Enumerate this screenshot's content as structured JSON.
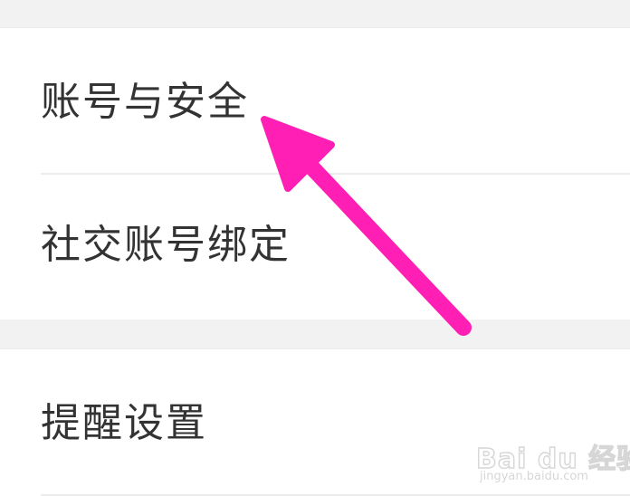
{
  "settings": {
    "items": [
      {
        "label": "账号与安全"
      },
      {
        "label": "社交账号绑定"
      },
      {
        "label": "提醒设置"
      }
    ]
  },
  "annotation": {
    "arrow_color": "#ff1fb4"
  },
  "watermark": {
    "logo": "Bai du 经验",
    "url": "jingyan.baidu.com"
  }
}
